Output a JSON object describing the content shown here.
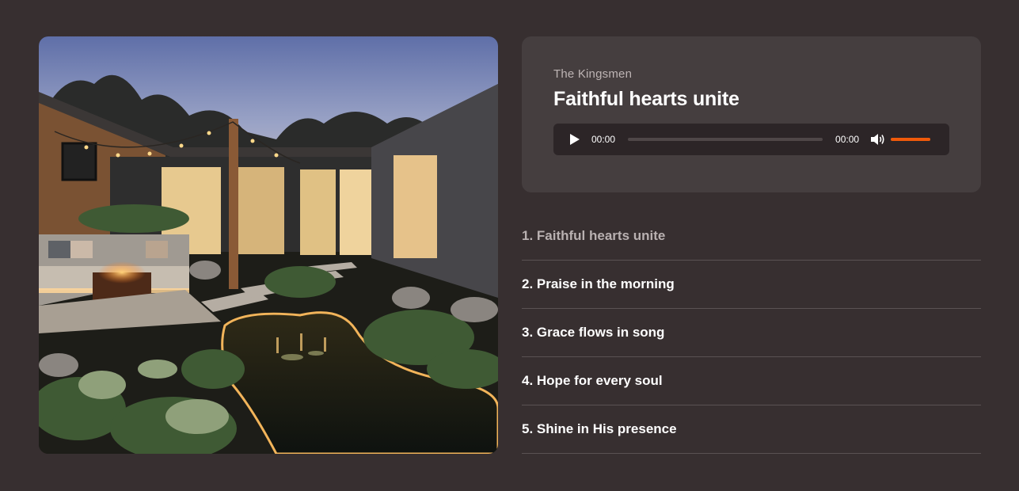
{
  "player": {
    "artist": "The Kingsmen",
    "title": "Faithful hearts unite",
    "current_time": "00:00",
    "duration": "00:00",
    "volume": 1.0,
    "play_icon": "play-icon",
    "volume_icon": "volume-icon",
    "accent_color": "#f05a0a"
  },
  "playlist": [
    {
      "label": "1. Faithful hearts unite",
      "active": true
    },
    {
      "label": "2. Praise in the morning",
      "active": false
    },
    {
      "label": "3. Grace flows in song",
      "active": false
    },
    {
      "label": "4. Hope for every soul",
      "active": false
    },
    {
      "label": "5. Shine in His presence",
      "active": false
    }
  ],
  "colors": {
    "background": "#372f30",
    "card": "#453e3f",
    "audio_bar": "#2c2527",
    "active_track": "#b9b1b1"
  }
}
